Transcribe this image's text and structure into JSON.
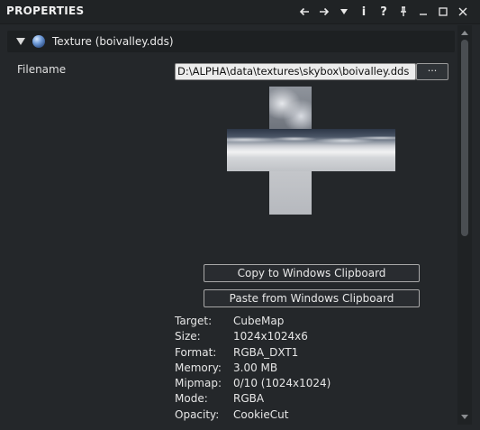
{
  "panel": {
    "title": "PROPERTIES",
    "titlebar_icons": [
      {
        "name": "back-arrow-icon",
        "glyph": "←"
      },
      {
        "name": "forward-arrow-icon",
        "glyph": "→"
      },
      {
        "name": "dropdown-arrow-icon",
        "glyph": "▼"
      },
      {
        "name": "info-icon",
        "glyph": "i"
      },
      {
        "name": "help-icon",
        "glyph": "?"
      },
      {
        "name": "pin-icon",
        "glyph": "⊥"
      },
      {
        "name": "minimize-icon",
        "glyph": "—"
      },
      {
        "name": "maximize-icon",
        "glyph": "□"
      },
      {
        "name": "close-icon",
        "glyph": "✕"
      }
    ]
  },
  "section": {
    "label": "Texture (boivalley.dds)",
    "icon": "globe-icon"
  },
  "filename": {
    "label": "Filename",
    "value": "D:\\ALPHA\\data\\textures\\skybox\\boivalley.dds",
    "browse_label": "···"
  },
  "buttons": {
    "copy": "Copy to Windows Clipboard",
    "paste": "Paste from Windows Clipboard"
  },
  "info": [
    {
      "key": "Target:",
      "value": "CubeMap"
    },
    {
      "key": "Size:",
      "value": "1024x1024x6"
    },
    {
      "key": "Format:",
      "value": "RGBA_DXT1"
    },
    {
      "key": "Memory:",
      "value": "3.00 MB"
    },
    {
      "key": "Mipmap:",
      "value": "0/10 (1024x1024)"
    },
    {
      "key": "Mode:",
      "value": "RGBA"
    },
    {
      "key": "Opacity:",
      "value": "CookieCut"
    }
  ],
  "colors": {
    "background": "#24272a",
    "header": "#1d2022",
    "text": "#e6e6e6"
  }
}
